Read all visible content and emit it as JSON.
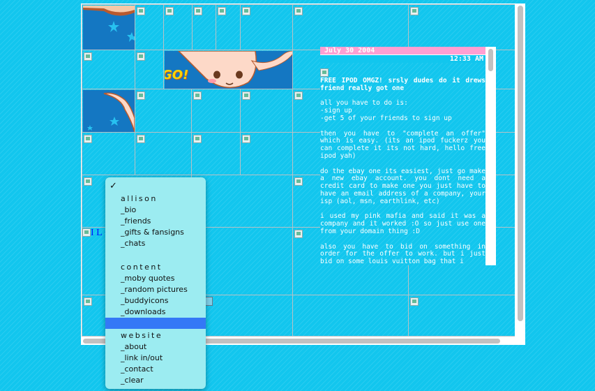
{
  "blog": {
    "date": "July 30 2004",
    "time": "12:33 AM",
    "title": "FREE IPOD OMGZ! srsly dudes do it drews friend really got one",
    "paragraphs": [
      "all you have to do is:\n-sign up\n-get 5 of your friends to sign up",
      "then you have to \"complete an offer\" which is easy. (its an ipod fuckerz you can complete it its not hard, hello free ipod yah)",
      "do the ebay one its easiest, just go make a new ebay account. you dont need a credit card to make one you just have to have an email address of a company, your isp (aol, msn, earthlink, etc)",
      "i used my pink mafia and said it was a company and it worked :O so just use one from your domain thing :D",
      "also you have to bid on something in order for the offer to work. but i just bid on some louis vuitton bag that i"
    ]
  },
  "sidebar_text": "I L <3",
  "art_text": "GO!",
  "menu": {
    "check_glyph": "✓",
    "items": [
      "allison",
      "_bio",
      "_friends",
      "_gifts & fansigns",
      "_chats",
      "content",
      "_moby quotes",
      "_random pictures",
      "_buddyicons",
      "_downloads",
      "website",
      "_about",
      "_link in/out",
      "_contact",
      "_clear"
    ]
  },
  "colors": {
    "background": "#12c6ee",
    "date_bar": "#ff9fd2",
    "menu_bg": "#9cecf1",
    "menu_selected": "#3478f6"
  }
}
